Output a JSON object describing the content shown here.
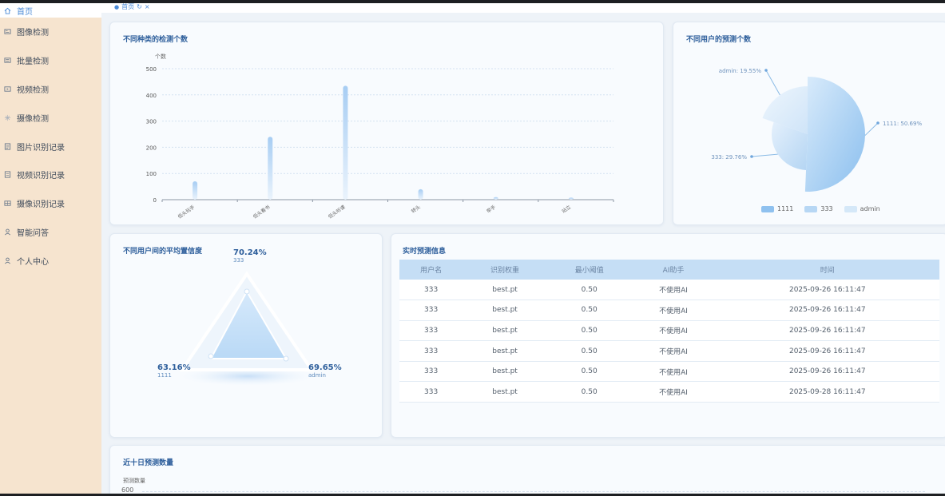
{
  "sidebar": {
    "items": [
      {
        "label": "首页",
        "icon": "home-icon"
      },
      {
        "label": "图像检测",
        "icon": "image-icon"
      },
      {
        "label": "批量检测",
        "icon": "batch-icon"
      },
      {
        "label": "视频检测",
        "icon": "video-icon"
      },
      {
        "label": "摄像检测",
        "icon": "camera-icon"
      },
      {
        "label": "图片识别记录",
        "icon": "image-record-icon"
      },
      {
        "label": "视频识别记录",
        "icon": "video-record-icon"
      },
      {
        "label": "摄像识别记录",
        "icon": "camera-record-icon"
      },
      {
        "label": "智能问答",
        "icon": "user-icon"
      },
      {
        "label": "个人中心",
        "icon": "user-icon"
      }
    ]
  },
  "tabs": {
    "current": "首页"
  },
  "panels": {
    "category": {
      "title": "不同种类的检测个数"
    },
    "users": {
      "title": "不同用户的预测个数"
    },
    "confidence": {
      "title": "不同用户间的平均置信度"
    },
    "realtime": {
      "title": "实时预测信息"
    },
    "tenday": {
      "title": "近十日预测数量",
      "ylabel": "预测数量",
      "ytick": "600"
    }
  },
  "chart_data": [
    {
      "type": "bar",
      "title": "不同种类的检测个数",
      "ylabel": "个数",
      "ylim": [
        0,
        500
      ],
      "yticks": [
        "500",
        "400",
        "300",
        "200",
        "100",
        "0"
      ],
      "categories": [
        "低头玩手",
        "低头看书",
        "低头听课",
        "转头",
        "举手",
        "站立"
      ],
      "values": [
        70,
        240,
        435,
        40,
        10,
        8
      ]
    },
    {
      "type": "pie",
      "title": "不同用户的预测个数",
      "slices": [
        {
          "name": "1111",
          "value": 50.69,
          "label": "1111: 50.69%"
        },
        {
          "name": "333",
          "value": 29.76,
          "label": "333: 29.76%"
        },
        {
          "name": "admin",
          "value": 19.55,
          "label": "admin: 19.55%"
        }
      ],
      "legend": [
        "1111",
        "333",
        "admin"
      ]
    },
    {
      "type": "radar",
      "title": "不同用户间的平均置信度",
      "points": [
        {
          "name": "333",
          "value": "70.24%"
        },
        {
          "name": "1111",
          "value": "63.16%"
        },
        {
          "name": "admin",
          "value": "69.65%"
        }
      ]
    },
    {
      "type": "table",
      "title": "实时预测信息",
      "columns": [
        "用户名",
        "识别权重",
        "最小阈值",
        "AI助手",
        "时间"
      ],
      "rows": [
        [
          "333",
          "best.pt",
          "0.50",
          "不使用AI",
          "2025-09-26 16:11:47"
        ],
        [
          "333",
          "best.pt",
          "0.50",
          "不使用AI",
          "2025-09-26 16:11:47"
        ],
        [
          "333",
          "best.pt",
          "0.50",
          "不使用AI",
          "2025-09-26 16:11:47"
        ],
        [
          "333",
          "best.pt",
          "0.50",
          "不使用AI",
          "2025-09-26 16:11:47"
        ],
        [
          "333",
          "best.pt",
          "0.50",
          "不使用AI",
          "2025-09-26 16:11:47"
        ],
        [
          "333",
          "best.pt",
          "0.50",
          "不使用AI",
          "2025-09-28 16:11:47"
        ]
      ]
    }
  ],
  "colors": {
    "accent": "#4a8ad6",
    "sidebar_bg": "#f6e4cf",
    "header_bg": "#c5def5"
  }
}
